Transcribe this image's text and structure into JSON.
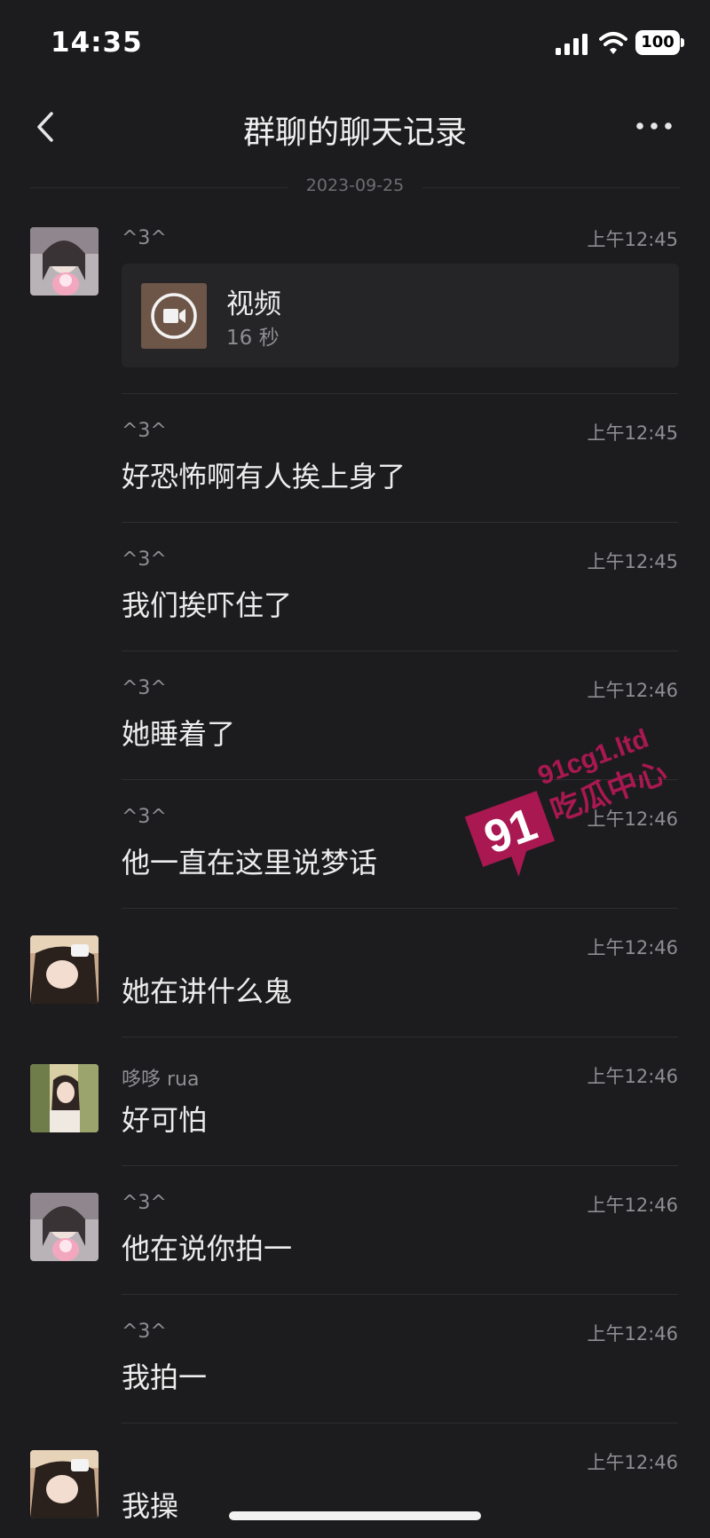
{
  "status_bar": {
    "time": "14:35",
    "battery": "100"
  },
  "nav": {
    "title": "群聊的聊天记录"
  },
  "date_separator": "2023-09-25",
  "messages": [
    {
      "sender": "^3^",
      "time": "上午12:45",
      "video": {
        "title": "视频",
        "duration": "16 秒"
      }
    },
    {
      "sender": "^3^",
      "time": "上午12:45",
      "text": "好恐怖啊有人挨上身了"
    },
    {
      "sender": "^3^",
      "time": "上午12:45",
      "text": "我们挨吓住了"
    },
    {
      "sender": "^3^",
      "time": "上午12:46",
      "text": "她睡着了"
    },
    {
      "sender": "^3^",
      "time": "上午12:46",
      "text": "他一直在这里说梦话"
    },
    {
      "sender": "",
      "time": "上午12:46",
      "text": "她在讲什么鬼"
    },
    {
      "sender": "哆哆 rua",
      "time": "上午12:46",
      "text": "好可怕"
    },
    {
      "sender": "^3^",
      "time": "上午12:46",
      "text": "他在说你拍一"
    },
    {
      "sender": "^3^",
      "time": "上午12:46",
      "text": "我拍一"
    },
    {
      "sender": "",
      "time": "上午12:46",
      "text": "我操"
    }
  ],
  "watermark": {
    "badge": "91",
    "domain": "91cg1.ltd",
    "name": "吃瓜中心"
  },
  "colors": {
    "background": "#1c1c1e",
    "text": "#ececec",
    "meta": "#8e8e93",
    "watermark": "#c2185b"
  }
}
